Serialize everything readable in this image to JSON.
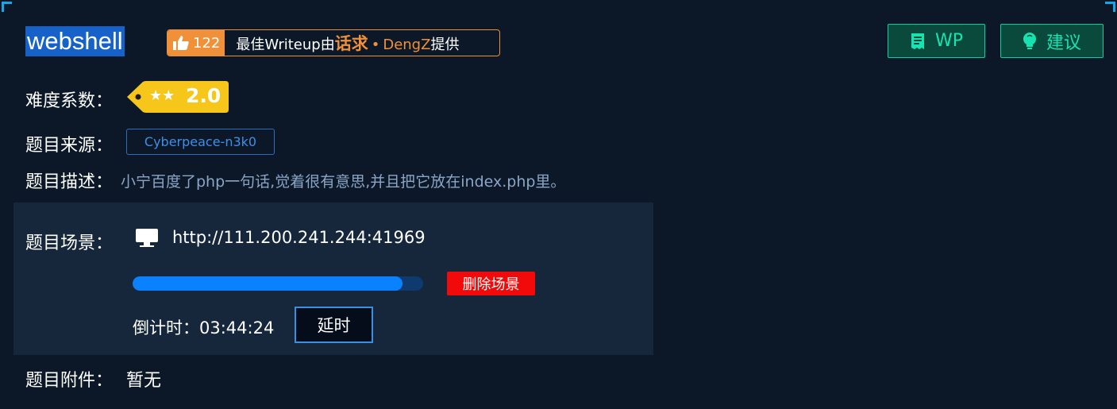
{
  "challenge": {
    "title": "webshell",
    "likes": "122",
    "writeup_prefix": "最佳Writeup由",
    "writeup_solver": "话求",
    "writeup_separator": "•",
    "writeup_author": "DengZ",
    "writeup_suffix": "提供"
  },
  "actions": {
    "wp_label": "WP",
    "suggest_label": "建议"
  },
  "info": {
    "difficulty_label": "难度系数：",
    "difficulty_stars": "★★",
    "difficulty_value": "2.0",
    "source_label": "题目来源：",
    "source_value": "Cyberpeace-n3k0",
    "desc_label": "题目描述：",
    "desc_value": "小宁百度了php一句话,觉着很有意思,并且把它放在index.php里。"
  },
  "scene": {
    "label": "题目场景：",
    "url": "http://111.200.241.244:41969",
    "progress_fraction": 0.93,
    "delete_label": "删除场景",
    "countdown_label": "倒计时：",
    "countdown_value": "03:44:24",
    "extend_label": "延时"
  },
  "attachments": {
    "label": "题目附件：",
    "value": "暂无"
  },
  "colors": {
    "background": "#0c1828",
    "scene_panel": "#16273c",
    "accent_orange": "#f0913a",
    "accent_green": "#17e3b0",
    "progress_fill": "#0a82ff",
    "danger": "#f20a0a",
    "tag_yellow": "#f7c61a"
  }
}
